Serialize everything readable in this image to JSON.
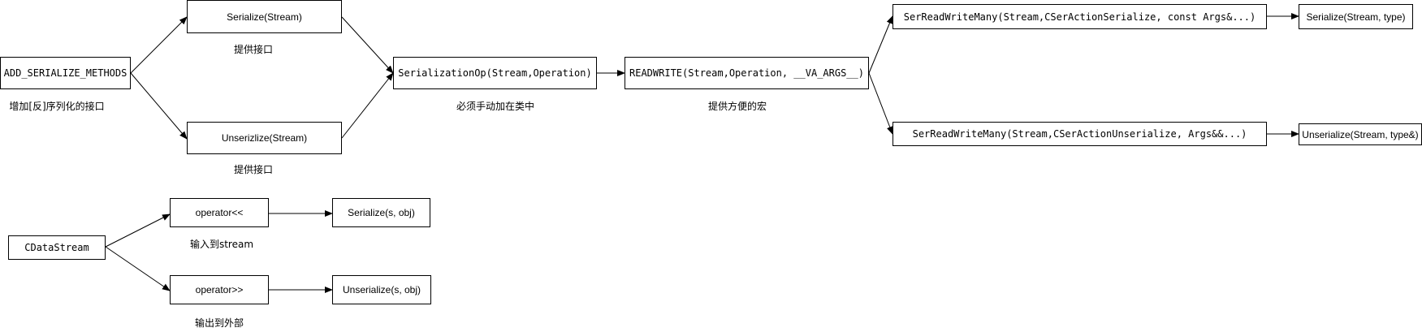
{
  "nodes": {
    "add_serialize_methods": "ADD_SERIALIZE_METHODS",
    "serialize_stream": "Serialize(Stream)",
    "unserialize_stream": "Unserizlize(Stream)",
    "serialization_op": "SerializationOp(Stream,Operation)",
    "readwrite": "READWRITE(Stream,Operation, __VA_ARGS__)",
    "ser_rw_many_serialize": "SerReadWriteMany(Stream,CSerActionSerialize, const Args&...)",
    "ser_rw_many_unserialize": "SerReadWriteMany(Stream,CSerActionUnserialize, Args&&...)",
    "serialize_stream_type": "Serialize(Stream, type)",
    "unserialize_stream_type": "Unserialize(Stream, type&)",
    "cdatastream": "CDataStream",
    "operator_out": "operator<<",
    "operator_in": "operator>>",
    "serialize_s_obj": "Serialize(s, obj)",
    "unserialize_s_obj": "Unserialize(s, obj)"
  },
  "labels": {
    "add_serialize_methods": "增加[反]序列化的接口",
    "serialize_provides": "提供接口",
    "unserialize_provides": "提供接口",
    "serialization_op": "必须手动加在类中",
    "readwrite": "提供方便的宏",
    "operator_out": "输入到stream",
    "operator_in": "输出到外部"
  },
  "colors": {
    "stroke": "#000000",
    "background": "#ffffff",
    "text": "#000000"
  }
}
